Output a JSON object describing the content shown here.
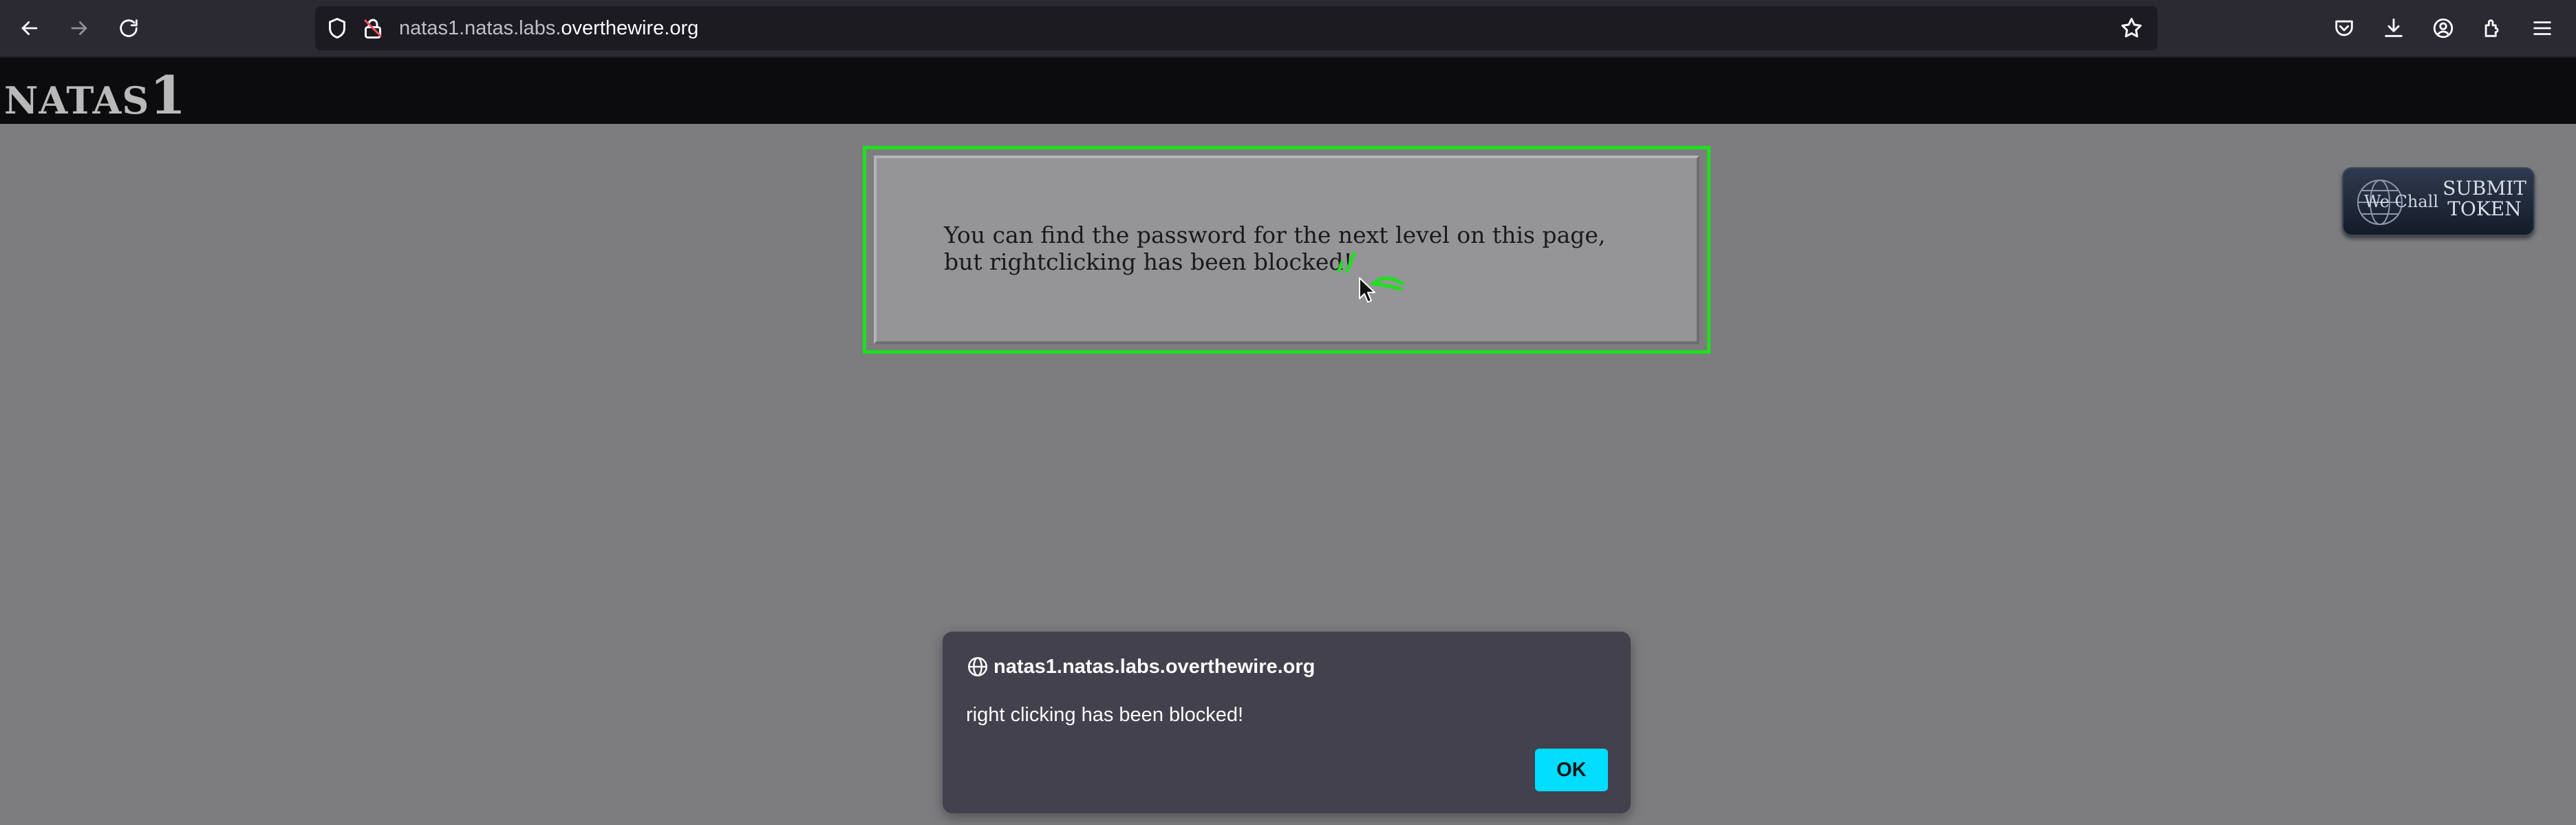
{
  "browser": {
    "url_prefix": "natas1.natas.labs.",
    "url_domain": "overthewire.org",
    "toolbar_icons": [
      "back-icon",
      "forward-icon",
      "reload-icon",
      "shield-icon",
      "lock-icon",
      "star-icon",
      "pocket-icon",
      "download-icon",
      "account-icon",
      "extensions-icon",
      "menu-icon"
    ]
  },
  "header": {
    "title_word": "NATAS",
    "title_num": "1"
  },
  "content": {
    "text": "You can find the password for the next level on this page, but rightclicking has been blocked!"
  },
  "wechall": {
    "brand": "We Chall",
    "line1": "SUBMIT",
    "line2": "TOKEN"
  },
  "dialog": {
    "origin": "natas1.natas.labs.overthewire.org",
    "message": "right clicking has been blocked!",
    "ok_label": "OK"
  },
  "colors": {
    "highlight": "#1ee01e",
    "ok_button": "#00ddff",
    "page_background": "#7d7d80"
  }
}
